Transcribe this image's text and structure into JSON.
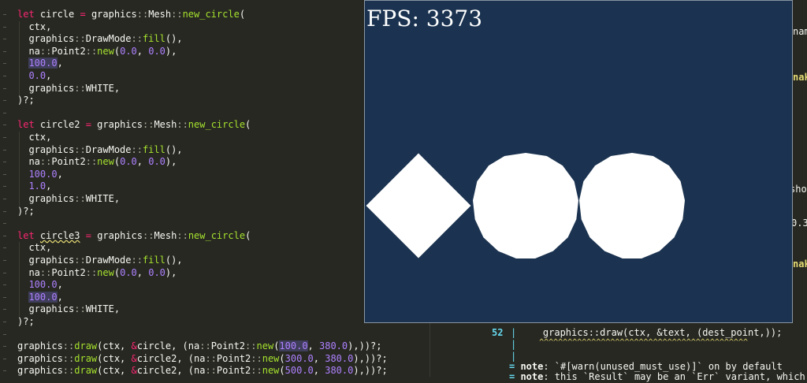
{
  "editor": {
    "lines": [
      [
        [
          "kw",
          "let"
        ],
        [
          "t",
          " circle "
        ],
        [
          "kw",
          "="
        ],
        [
          "t",
          " graphics"
        ],
        [
          "sep",
          "::"
        ],
        [
          "t",
          "Mesh"
        ],
        [
          "sep",
          "::"
        ],
        [
          "fn",
          "new_circle"
        ],
        [
          "t",
          "("
        ]
      ],
      [
        [
          "t",
          "  ctx,"
        ]
      ],
      [
        [
          "t",
          "  graphics"
        ],
        [
          "sep",
          "::"
        ],
        [
          "t",
          "DrawMode"
        ],
        [
          "sep",
          "::"
        ],
        [
          "fn",
          "fill"
        ],
        [
          "t",
          "(),"
        ]
      ],
      [
        [
          "t",
          "  na"
        ],
        [
          "sep",
          "::"
        ],
        [
          "t",
          "Point2"
        ],
        [
          "sep",
          "::"
        ],
        [
          "fn",
          "new"
        ],
        [
          "t",
          "("
        ],
        [
          "num",
          "0.0"
        ],
        [
          "t",
          ", "
        ],
        [
          "num",
          "0.0"
        ],
        [
          "t",
          "),"
        ]
      ],
      [
        [
          "t",
          "  "
        ],
        [
          "numhl",
          "100.0"
        ],
        [
          "t",
          ","
        ]
      ],
      [
        [
          "t",
          "  "
        ],
        [
          "num",
          "0.0"
        ],
        [
          "t",
          ","
        ]
      ],
      [
        [
          "t",
          "  graphics"
        ],
        [
          "sep",
          "::"
        ],
        [
          "t",
          "WHITE,"
        ]
      ],
      [
        [
          "t",
          ")?;"
        ]
      ],
      [
        [
          "t",
          ""
        ]
      ],
      [
        [
          "kw",
          "let"
        ],
        [
          "t",
          " circle2 "
        ],
        [
          "kw",
          "="
        ],
        [
          "t",
          " graphics"
        ],
        [
          "sep",
          "::"
        ],
        [
          "t",
          "Mesh"
        ],
        [
          "sep",
          "::"
        ],
        [
          "fn",
          "new_circle"
        ],
        [
          "t",
          "("
        ]
      ],
      [
        [
          "t",
          "  ctx,"
        ]
      ],
      [
        [
          "t",
          "  graphics"
        ],
        [
          "sep",
          "::"
        ],
        [
          "t",
          "DrawMode"
        ],
        [
          "sep",
          "::"
        ],
        [
          "fn",
          "fill"
        ],
        [
          "t",
          "(),"
        ]
      ],
      [
        [
          "t",
          "  na"
        ],
        [
          "sep",
          "::"
        ],
        [
          "t",
          "Point2"
        ],
        [
          "sep",
          "::"
        ],
        [
          "fn",
          "new"
        ],
        [
          "t",
          "("
        ],
        [
          "num",
          "0.0"
        ],
        [
          "t",
          ", "
        ],
        [
          "num",
          "0.0"
        ],
        [
          "t",
          "),"
        ]
      ],
      [
        [
          "t",
          "  "
        ],
        [
          "num",
          "100.0"
        ],
        [
          "t",
          ","
        ]
      ],
      [
        [
          "t",
          "  "
        ],
        [
          "num",
          "1.0"
        ],
        [
          "t",
          ","
        ]
      ],
      [
        [
          "t",
          "  graphics"
        ],
        [
          "sep",
          "::"
        ],
        [
          "t",
          "WHITE,"
        ]
      ],
      [
        [
          "t",
          ")?;"
        ]
      ],
      [
        [
          "t",
          ""
        ]
      ],
      [
        [
          "kw",
          "let"
        ],
        [
          "t",
          " "
        ],
        [
          "sq",
          "circle3"
        ],
        [
          "t",
          " "
        ],
        [
          "kw",
          "="
        ],
        [
          "t",
          " graphics"
        ],
        [
          "sep",
          "::"
        ],
        [
          "t",
          "Mesh"
        ],
        [
          "sep",
          "::"
        ],
        [
          "fn",
          "new_circle"
        ],
        [
          "t",
          "("
        ]
      ],
      [
        [
          "t",
          "  ctx,"
        ]
      ],
      [
        [
          "t",
          "  graphics"
        ],
        [
          "sep",
          "::"
        ],
        [
          "t",
          "DrawMode"
        ],
        [
          "sep",
          "::"
        ],
        [
          "fn",
          "fill"
        ],
        [
          "t",
          "(),"
        ]
      ],
      [
        [
          "t",
          "  na"
        ],
        [
          "sep",
          "::"
        ],
        [
          "t",
          "Point2"
        ],
        [
          "sep",
          "::"
        ],
        [
          "fn",
          "new"
        ],
        [
          "t",
          "("
        ],
        [
          "num",
          "0.0"
        ],
        [
          "t",
          ", "
        ],
        [
          "num",
          "0.0"
        ],
        [
          "t",
          "),"
        ]
      ],
      [
        [
          "t",
          "  "
        ],
        [
          "num",
          "100.0"
        ],
        [
          "t",
          ","
        ]
      ],
      [
        [
          "t",
          "  "
        ],
        [
          "numhl",
          "100.0"
        ],
        [
          "t",
          ","
        ]
      ],
      [
        [
          "t",
          "  graphics"
        ],
        [
          "sep",
          "::"
        ],
        [
          "t",
          "WHITE,"
        ]
      ],
      [
        [
          "t",
          ")?;"
        ]
      ],
      [
        [
          "t",
          ""
        ]
      ],
      [
        [
          "t",
          "graphics"
        ],
        [
          "sep",
          "::"
        ],
        [
          "fn",
          "draw"
        ],
        [
          "t",
          "(ctx, "
        ],
        [
          "kw",
          "&"
        ],
        [
          "t",
          "circle, (na"
        ],
        [
          "sep",
          "::"
        ],
        [
          "t",
          "Point2"
        ],
        [
          "sep",
          "::"
        ],
        [
          "fn",
          "new"
        ],
        [
          "t",
          "("
        ],
        [
          "numhl",
          "100.0"
        ],
        [
          "t",
          ", "
        ],
        [
          "num",
          "380.0"
        ],
        [
          "t",
          "),))?;"
        ]
      ],
      [
        [
          "t",
          "graphics"
        ],
        [
          "sep",
          "::"
        ],
        [
          "fn",
          "draw"
        ],
        [
          "t",
          "(ctx, "
        ],
        [
          "kw",
          "&"
        ],
        [
          "t",
          "circle2, (na"
        ],
        [
          "sep",
          "::"
        ],
        [
          "t",
          "Point2"
        ],
        [
          "sep",
          "::"
        ],
        [
          "fn",
          "new"
        ],
        [
          "t",
          "("
        ],
        [
          "num",
          "300.0"
        ],
        [
          "t",
          ", "
        ],
        [
          "num",
          "380.0"
        ],
        [
          "t",
          "),))?;"
        ]
      ],
      [
        [
          "t",
          "graphics"
        ],
        [
          "sep",
          "::"
        ],
        [
          "fn",
          "draw"
        ],
        [
          "t",
          "(ctx, "
        ],
        [
          "kw",
          "&"
        ],
        [
          "t",
          "circle2, (na"
        ],
        [
          "sep",
          "::"
        ],
        [
          "t",
          "Point2"
        ],
        [
          "sep",
          "::"
        ],
        [
          "fn",
          "new"
        ],
        [
          "t",
          "("
        ],
        [
          "num",
          "500.0"
        ],
        [
          "t",
          ", "
        ],
        [
          "num",
          "380.0"
        ],
        [
          "t",
          "),))?;"
        ]
      ]
    ]
  },
  "terminal": {
    "right_fragments": [
      {
        "text": "nam",
        "color": "#f8f8f2"
      },
      {
        "text": "nak",
        "color": "#e6db74"
      },
      {
        "text": "sho",
        "color": "#f8f8f2"
      },
      {
        "text": "0.3",
        "color": "#f8f8f2"
      },
      {
        "text": "nak",
        "color": "#e6db74"
      }
    ],
    "line_number": "52",
    "pipe": "|",
    "code": "    graphics::draw(ctx, &text, (dest_point,));",
    "carets": "    ^^^^^^^^^^^^^^^^^^^^^^^^^^^^^^^^^^^^^^^^^^^^",
    "note1_prefix": "= ",
    "note1_label": "note",
    "note1_text": ": `#[warn(unused_must_use)]` on by default",
    "note2_prefix": "= ",
    "note2_label": "note",
    "note2_text": ": this `Result` may be an `Err` variant, which sho"
  },
  "game_window": {
    "fps_label": "FPS: 3373",
    "background": "#1b3350",
    "shape_color": "#ffffff"
  }
}
